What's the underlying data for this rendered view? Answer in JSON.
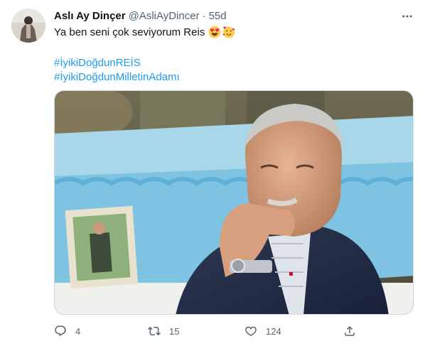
{
  "tweet": {
    "author_name": "Aslı Ay Dinçer",
    "author_handle": "@AsliAyDincer",
    "separator": "·",
    "time": "55d",
    "text": "Ya ben seni çok seviyorum Reis",
    "emojis": [
      "heart-eyes-emoji",
      "smiling-face-with-hearts-emoji"
    ],
    "hashtags": [
      "#İyikiDoğdunREİS",
      "#İyikiDoğdunMilletinAdamı"
    ],
    "media": {
      "type": "photo"
    },
    "actions": {
      "reply_count": "4",
      "retweet_count": "15",
      "like_count": "124"
    }
  },
  "icons": [
    "more-icon",
    "reply-icon",
    "retweet-icon",
    "like-icon",
    "share-icon"
  ],
  "colors": {
    "link": "#1d9bf0",
    "secondary_text": "#536471",
    "text": "#0f1419",
    "border": "#cfd9de"
  }
}
